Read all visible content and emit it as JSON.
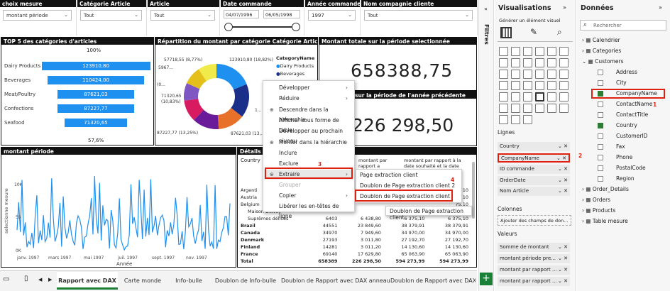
{
  "slicers": [
    {
      "title": "choix mesure",
      "value": "montant période"
    },
    {
      "title": "Catégorie Article",
      "value": "Tout"
    },
    {
      "title": "Article",
      "value": "Tout"
    },
    {
      "title": "Date commande",
      "date_from": "04/07/1996",
      "date_to": "06/05/1998"
    },
    {
      "title": "Année commande",
      "value": "1997"
    },
    {
      "title": "Nom compagnie cliente",
      "value": "Tout"
    }
  ],
  "top5": {
    "title": "TOP 5 des catégories d'articles",
    "top_pct": "100%",
    "bottom_pct": "57,6%",
    "items": [
      {
        "label": "Dairy Products",
        "value": "123910,80",
        "fraction": 1.0
      },
      {
        "label": "Beverages",
        "value": "110424,00",
        "fraction": 0.891
      },
      {
        "label": "Meat/Poultry",
        "value": "87621,03",
        "fraction": 0.707
      },
      {
        "label": "Confections",
        "value": "87227,77",
        "fraction": 0.704
      },
      {
        "label": "Seafood",
        "value": "71320,65",
        "fraction": 0.576
      }
    ]
  },
  "donut": {
    "title": "Répartition du montant par catégorie Catégorie Article",
    "legend_title": "CategoryName",
    "legend": [
      {
        "name": "Dairy Products",
        "color": "#1e90f0"
      },
      {
        "name": "Beverages",
        "color": "#1a2f8a"
      }
    ],
    "labels": [
      "57718,55 (8,77%)",
      "5967...",
      "(0...",
      "123910,80 (18,82%)",
      "71320,65",
      "(10,83%)",
      "87227,77 (13,25%)",
      "87621,03 (13,...",
      "1..."
    ]
  },
  "kpi1": {
    "title": "Montant totale sur la période selectionnée",
    "value": "658388,75"
  },
  "kpi2": {
    "title": "sur la période de l'année précédente",
    "value": "226 298,50"
  },
  "line_chart": {
    "title": "montant période",
    "ylabel": "selectionne mesure",
    "xlabel": "Année",
    "y_ticks": [
      "10K",
      "5K",
      "0K"
    ],
    "x_ticks": [
      "janv. 1997",
      "mars 1997",
      "mai 1997",
      "juil. 1997",
      "sept. 1997",
      "nov. 1997"
    ]
  },
  "details": {
    "title": "Détails co",
    "col_country": "Country",
    "col3": "montant par rapport a",
    "col4": "montant par rapport à la date souhaité et la date",
    "rows": [
      {
        "name": "Argenti",
        "v1": "",
        "v2": "",
        "v3": "",
        "v4": "34,10"
      },
      {
        "name": "Austria",
        "v1": "",
        "v2": "",
        "v3": "",
        "v4": "84,10"
      },
      {
        "name": "Belgium",
        "v1": "",
        "v2": "",
        "v3": "",
        "v4": "75,10"
      },
      {
        "name": "Maison Dewey",
        "v1": "",
        "v2": "",
        "v3": "",
        "v4": ""
      },
      {
        "name": "Suprêmes délices",
        "v1": "6403",
        "v2": "6 438,80",
        "v3": "6 375,10",
        "v4": "6 375,10"
      },
      {
        "name": "Brazil",
        "v1": "44551",
        "v2": "23 849,60",
        "v3": "38 379,91",
        "v4": "38 379,91"
      },
      {
        "name": "Canada",
        "v1": "34970",
        "v2": "7 949,60",
        "v3": "34 970,00",
        "v4": "34 970,00"
      },
      {
        "name": "Denmark",
        "v1": "27193",
        "v2": "3 011,80",
        "v3": "27 192,70",
        "v4": "27 192,70"
      },
      {
        "name": "Finland",
        "v1": "14281",
        "v2": "3 011,20",
        "v3": "14 130,60",
        "v4": "14 130,60"
      },
      {
        "name": "France",
        "v1": "69140",
        "v2": "17 629,80",
        "v3": "65 063,90",
        "v4": "65 063,90"
      },
      {
        "name": "Total",
        "v1": "658389",
        "v2": "226 298,50",
        "v3": "594 273,99",
        "v4": "594 273,99"
      }
    ]
  },
  "context_menu": {
    "items": [
      "Développer",
      "Réduire",
      "Descendre dans la hiérarchie",
      "Afficher sous forme de table",
      "Développer au prochain niveau",
      "Monter dans la hiérarchie",
      "Inclure",
      "Exclure",
      "Extraire",
      "Grouper",
      "Copier",
      "Libérer les en-têtes de ligne"
    ],
    "submenu": [
      "Page extraction client",
      "Doublon de Page extraction client 2",
      "Doublon de Page extraction client"
    ],
    "tooltip": "Doublon de Page extraction client"
  },
  "annotations": [
    "1",
    "2",
    "3",
    "4"
  ],
  "filters_label": "Filtres",
  "visualisations": {
    "title": "Visualisations",
    "subtitle": "Générer un élément visuel",
    "lignes_label": "Lignes",
    "lignes": [
      "Country",
      "CompanyName",
      "ID commande",
      "OrderDate",
      "Nom Article"
    ],
    "colonnes_label": "Colonnes",
    "colonnes_placeholder": "Ajouter des champs de don...",
    "valeurs_label": "Valeurs",
    "valeurs": [
      "Somme de montant",
      "montant période pre...",
      "montant par rapport ...",
      "montant par rapport ..."
    ]
  },
  "donnees": {
    "title": "Données",
    "search_placeholder": "Rechercher",
    "tables": [
      "Calendrier",
      "Categories",
      "Customers",
      "Order_Details",
      "Orders",
      "Products",
      "Table mesure"
    ],
    "customer_fields": [
      {
        "name": "Address",
        "checked": false
      },
      {
        "name": "City",
        "checked": false
      },
      {
        "name": "CompanyName",
        "checked": true
      },
      {
        "name": "ContactName",
        "checked": false
      },
      {
        "name": "ContactTitle",
        "checked": false
      },
      {
        "name": "Country",
        "checked": true
      },
      {
        "name": "CustomerID",
        "checked": false
      },
      {
        "name": "Fax",
        "checked": false
      },
      {
        "name": "Phone",
        "checked": false
      },
      {
        "name": "PostalCode",
        "checked": false
      },
      {
        "name": "Region",
        "checked": false
      }
    ]
  },
  "tabs": [
    "Rapport avec DAX",
    "Carte monde",
    "Info-bulle",
    "Doublon de Info-bulle",
    "Doublon de Rapport avec DAX anneau",
    "Doublon de Rapport avec DAX ta"
  ],
  "colors": {
    "accent": "#1e90f0",
    "annotation": "#d21",
    "tab_active": "#1a7f37"
  }
}
